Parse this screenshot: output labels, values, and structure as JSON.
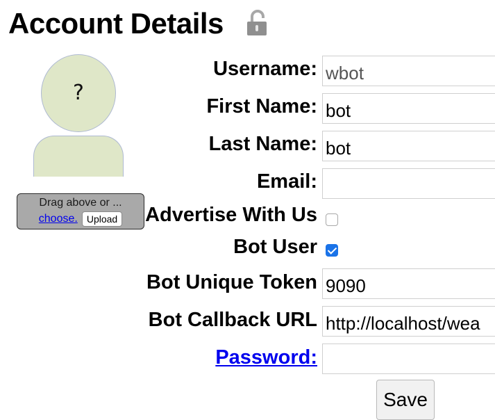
{
  "header": {
    "title": "Account Details",
    "lock_icon": "unlocked-padlock-icon"
  },
  "avatar": {
    "placeholder_glyph": "?"
  },
  "upload": {
    "hint": "Drag above or ...",
    "choose_label": "choose.",
    "button_label": "Upload"
  },
  "form": {
    "username": {
      "label": "Username:",
      "value": "wbot"
    },
    "first_name": {
      "label": "First Name:",
      "value": "bot"
    },
    "last_name": {
      "label": "Last Name:",
      "value": "bot"
    },
    "email": {
      "label": "Email:",
      "value": ""
    },
    "advertise": {
      "label": "Advertise With Us",
      "checked": false
    },
    "bot_user": {
      "label": "Bot User",
      "checked": true
    },
    "bot_token": {
      "label": "Bot Unique Token",
      "value": "9090"
    },
    "bot_callback": {
      "label": "Bot Callback URL",
      "value": "http://localhost/wea"
    },
    "password": {
      "label": "Password:",
      "value": ""
    },
    "save_label": "Save"
  },
  "colors": {
    "avatar_fill": "#dfe7c8",
    "link": "#0000ee",
    "checkbox_checked": "#1a73e8"
  }
}
